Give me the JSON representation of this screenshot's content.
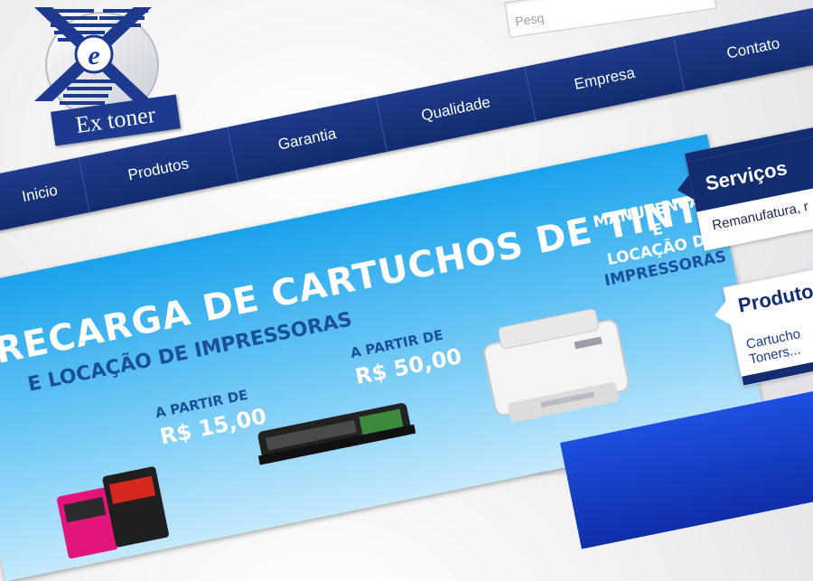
{
  "brand": {
    "logo_letter": "e",
    "wordmark": "Ex toner",
    "colors": {
      "navy": "#142c70",
      "blue": "#1d3a8f",
      "sky": "#1aa2ec"
    }
  },
  "search": {
    "placeholder": "Pesq"
  },
  "nav": {
    "items": [
      "Inicio",
      "Produtos",
      "Garantia",
      "Qualidade",
      "Empresa",
      "Contato"
    ]
  },
  "banner": {
    "headline": "RECARGA DE CARTUCHOS DE TINTA E DE TONER",
    "subheadline": "E LOCAÇÃO DE IMPRESSORAS",
    "offer_ink": {
      "label": "A PARTIR DE",
      "price": "R$ 15,00"
    },
    "offer_toner": {
      "label": "A PARTIR DE",
      "price": "R$ 50,00"
    },
    "service": [
      "MANUTENÇÃO E",
      "LOCAÇÃO DE",
      "IMPRESSORAS"
    ]
  },
  "sidebar": {
    "servicos": {
      "title": "Serviços",
      "text": "Remanufatura, r"
    },
    "produtos": {
      "title": "Produto",
      "line1": "Cartucho",
      "line2": "Toners..."
    }
  }
}
